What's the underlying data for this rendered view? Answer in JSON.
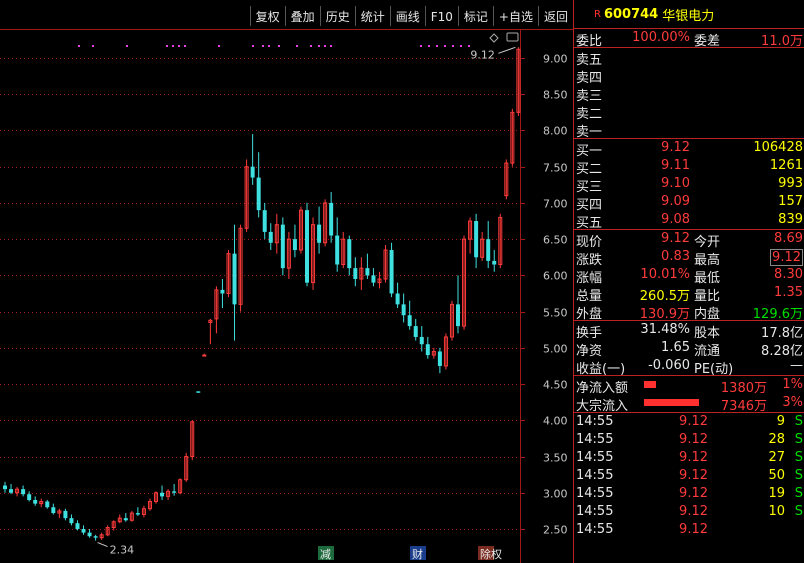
{
  "toolbar": [
    "复权",
    "叠加",
    "历史",
    "统计",
    "画线",
    "F10",
    "标记",
    "+自选",
    "返回"
  ],
  "stock": {
    "r_mark": "R",
    "code": "600744",
    "name": "华银电力"
  },
  "y_ticks": [
    "9.00",
    "8.50",
    "8.00",
    "7.50",
    "7.00",
    "6.50",
    "6.00",
    "5.50",
    "5.00",
    "4.50",
    "4.00",
    "3.50",
    "3.00",
    "2.50"
  ],
  "annot": {
    "high": "9.12",
    "low": "2.34"
  },
  "bottom_marks": [
    "减",
    "财",
    "除权"
  ],
  "colors": {
    "up": "#ff3b3b",
    "down": "#3fe0e0",
    "bg": "#000000",
    "grid": "#a01818",
    "accent": "#ffff00"
  },
  "chart_data": {
    "type": "candlestick",
    "ylim": [
      2.2,
      9.4
    ],
    "candles": [
      [
        3.1,
        3.15,
        3.0,
        3.05
      ],
      [
        3.05,
        3.12,
        2.98,
        3.0
      ],
      [
        3.0,
        3.08,
        2.95,
        3.05
      ],
      [
        3.05,
        3.1,
        2.95,
        2.98
      ],
      [
        2.98,
        3.02,
        2.88,
        2.9
      ],
      [
        2.9,
        2.95,
        2.82,
        2.85
      ],
      [
        2.85,
        2.92,
        2.8,
        2.88
      ],
      [
        2.88,
        2.9,
        2.78,
        2.8
      ],
      [
        2.8,
        2.85,
        2.7,
        2.72
      ],
      [
        2.72,
        2.78,
        2.65,
        2.75
      ],
      [
        2.75,
        2.78,
        2.62,
        2.65
      ],
      [
        2.65,
        2.7,
        2.55,
        2.58
      ],
      [
        2.58,
        2.62,
        2.48,
        2.5
      ],
      [
        2.5,
        2.55,
        2.42,
        2.45
      ],
      [
        2.45,
        2.5,
        2.38,
        2.4
      ],
      [
        2.4,
        2.42,
        2.34,
        2.38
      ],
      [
        2.38,
        2.45,
        2.35,
        2.42
      ],
      [
        2.42,
        2.55,
        2.4,
        2.52
      ],
      [
        2.52,
        2.62,
        2.48,
        2.6
      ],
      [
        2.6,
        2.7,
        2.58,
        2.65
      ],
      [
        2.65,
        2.72,
        2.6,
        2.62
      ],
      [
        2.62,
        2.75,
        2.6,
        2.72
      ],
      [
        2.72,
        2.8,
        2.68,
        2.7
      ],
      [
        2.7,
        2.82,
        2.66,
        2.78
      ],
      [
        2.78,
        2.92,
        2.75,
        2.88
      ],
      [
        2.88,
        3.02,
        2.85,
        3.0
      ],
      [
        3.0,
        3.1,
        2.9,
        2.95
      ],
      [
        2.95,
        3.05,
        2.9,
        3.02
      ],
      [
        3.02,
        3.12,
        2.96,
        3.0
      ],
      [
        3.0,
        3.2,
        2.98,
        3.18
      ],
      [
        3.18,
        3.55,
        3.15,
        3.5
      ],
      [
        3.5,
        4.0,
        3.45,
        3.98
      ],
      [
        4.4,
        4.4,
        4.38,
        4.38
      ],
      [
        4.9,
        4.92,
        4.88,
        4.9
      ],
      [
        5.35,
        5.4,
        5.05,
        5.38
      ],
      [
        5.4,
        5.85,
        5.2,
        5.8
      ],
      [
        5.8,
        5.95,
        5.55,
        5.75
      ],
      [
        5.75,
        6.35,
        5.7,
        6.3
      ],
      [
        6.3,
        6.7,
        5.1,
        5.6
      ],
      [
        5.6,
        6.7,
        5.5,
        6.65
      ],
      [
        6.65,
        7.6,
        6.6,
        7.5
      ],
      [
        7.5,
        7.95,
        7.25,
        7.35
      ],
      [
        7.35,
        7.7,
        6.8,
        6.9
      ],
      [
        6.9,
        7.0,
        6.5,
        6.6
      ],
      [
        6.6,
        6.72,
        6.35,
        6.45
      ],
      [
        6.45,
        6.85,
        6.3,
        6.7
      ],
      [
        6.7,
        6.8,
        6.0,
        6.1
      ],
      [
        6.1,
        6.6,
        5.95,
        6.5
      ],
      [
        6.5,
        6.7,
        6.25,
        6.35
      ],
      [
        6.35,
        6.95,
        6.3,
        6.9
      ],
      [
        6.9,
        7.0,
        5.85,
        5.9
      ],
      [
        5.9,
        6.8,
        5.8,
        6.7
      ],
      [
        6.7,
        6.95,
        6.3,
        6.45
      ],
      [
        6.45,
        7.05,
        6.4,
        7.0
      ],
      [
        7.0,
        7.15,
        6.45,
        6.55
      ],
      [
        6.55,
        6.8,
        6.05,
        6.15
      ],
      [
        6.15,
        6.6,
        6.1,
        6.5
      ],
      [
        6.5,
        6.55,
        6.0,
        6.1
      ],
      [
        6.1,
        6.25,
        5.85,
        5.95
      ],
      [
        5.95,
        6.25,
        5.8,
        6.1
      ],
      [
        6.1,
        6.3,
        5.95,
        6.0
      ],
      [
        6.0,
        6.1,
        5.85,
        5.9
      ],
      [
        5.9,
        6.05,
        5.82,
        5.95
      ],
      [
        5.95,
        6.42,
        5.9,
        6.35
      ],
      [
        6.35,
        6.45,
        5.7,
        5.75
      ],
      [
        5.75,
        5.9,
        5.55,
        5.6
      ],
      [
        5.6,
        5.75,
        5.35,
        5.45
      ],
      [
        5.45,
        5.65,
        5.25,
        5.3
      ],
      [
        5.3,
        5.4,
        5.1,
        5.15
      ],
      [
        5.15,
        5.3,
        4.95,
        5.05
      ],
      [
        5.05,
        5.15,
        4.85,
        4.9
      ],
      [
        4.9,
        5.0,
        4.85,
        4.95
      ],
      [
        4.95,
        5.0,
        4.65,
        4.75
      ],
      [
        4.75,
        5.2,
        4.7,
        5.15
      ],
      [
        5.15,
        5.65,
        5.1,
        5.6
      ],
      [
        5.6,
        6.0,
        5.2,
        5.3
      ],
      [
        5.3,
        6.55,
        5.25,
        6.5
      ],
      [
        6.5,
        6.8,
        6.3,
        6.75
      ],
      [
        6.75,
        6.85,
        6.1,
        6.25
      ],
      [
        6.25,
        6.6,
        6.2,
        6.5
      ],
      [
        6.5,
        6.75,
        6.1,
        6.2
      ],
      [
        6.2,
        6.35,
        6.05,
        6.15
      ],
      [
        6.15,
        6.85,
        6.1,
        6.8
      ],
      [
        7.1,
        7.6,
        7.05,
        7.55
      ],
      [
        7.55,
        8.3,
        7.5,
        8.25
      ],
      [
        8.25,
        9.15,
        8.2,
        9.12
      ]
    ]
  },
  "panel": {
    "weibi": {
      "label": "委比",
      "value": "100.00%",
      "label2": "委差",
      "value2": "11.0万"
    },
    "sells": [
      "卖五",
      "卖四",
      "卖三",
      "卖二",
      "卖一"
    ],
    "buys": [
      {
        "label": "买一",
        "price": "9.12",
        "vol": "106428"
      },
      {
        "label": "买二",
        "price": "9.11",
        "vol": "1261"
      },
      {
        "label": "买三",
        "price": "9.10",
        "vol": "993"
      },
      {
        "label": "买四",
        "price": "9.09",
        "vol": "157"
      },
      {
        "label": "买五",
        "price": "9.08",
        "vol": "839"
      }
    ],
    "stats": [
      {
        "l1": "现价",
        "v1": "9.12",
        "c1": "red",
        "l2": "今开",
        "v2": "8.69",
        "c2": "red",
        "box": false
      },
      {
        "l1": "涨跌",
        "v1": "0.83",
        "c1": "red",
        "l2": "最高",
        "v2": "9.12",
        "c2": "red",
        "box": true
      },
      {
        "l1": "涨幅",
        "v1": "10.01%",
        "c1": "red",
        "l2": "最低",
        "v2": "8.30",
        "c2": "red",
        "box": false
      },
      {
        "l1": "总量",
        "v1": "260.5万",
        "c1": "yellow",
        "l2": "量比",
        "v2": "1.35",
        "c2": "red",
        "box": false
      },
      {
        "l1": "外盘",
        "v1": "130.9万",
        "c1": "red",
        "l2": "内盘",
        "v2": "129.6万",
        "c2": "green",
        "box": false
      }
    ],
    "fin": [
      {
        "l1": "换手",
        "v1": "31.48%",
        "l2": "股本",
        "v2": "17.8亿"
      },
      {
        "l1": "净资",
        "v1": "1.65",
        "l2": "流通",
        "v2": "8.28亿"
      },
      {
        "l1": "收益(一)",
        "v1": "-0.060",
        "l2": "PE(动)",
        "v2": "—"
      }
    ],
    "flow": [
      {
        "label": "净流入额",
        "value": "1380万",
        "pct": "1%",
        "bar": 0.12
      },
      {
        "label": "大宗流入",
        "value": "7346万",
        "pct": "3%",
        "bar": 0.55
      }
    ],
    "ticks": [
      {
        "time": "14:55",
        "price": "9.12",
        "vol": "9",
        "flag": "S"
      },
      {
        "time": "14:55",
        "price": "9.12",
        "vol": "28",
        "flag": "S"
      },
      {
        "time": "14:55",
        "price": "9.12",
        "vol": "27",
        "flag": "S"
      },
      {
        "time": "14:55",
        "price": "9.12",
        "vol": "50",
        "flag": "S"
      },
      {
        "time": "14:55",
        "price": "9.12",
        "vol": "19",
        "flag": "S"
      },
      {
        "time": "14:55",
        "price": "9.12",
        "vol": "10",
        "flag": "S"
      },
      {
        "time": "14:55",
        "price": "9.12",
        "vol": "",
        "flag": ""
      }
    ]
  }
}
